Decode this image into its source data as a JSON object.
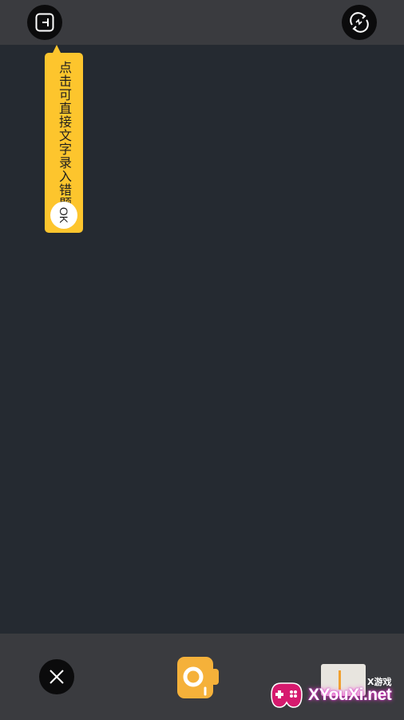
{
  "top_bar": {
    "text_input_icon": "text-entry-icon",
    "camera_switch_icon": "camera-switch-icon"
  },
  "tooltip": {
    "text": "点击可直接文字录入错题",
    "ok_label": "OK"
  },
  "bottom_bar": {
    "close_icon": "close-icon",
    "shutter_icon": "camera-shutter-icon",
    "gallery_icon": "gallery-thumbnail"
  },
  "watermark": {
    "small_text": "X游戏",
    "main_text": "XYouXi.net"
  },
  "colors": {
    "background": "#252a31",
    "bar": "#3a3b3f",
    "accent": "#fdc52d",
    "shutter": "#f5b13a"
  }
}
